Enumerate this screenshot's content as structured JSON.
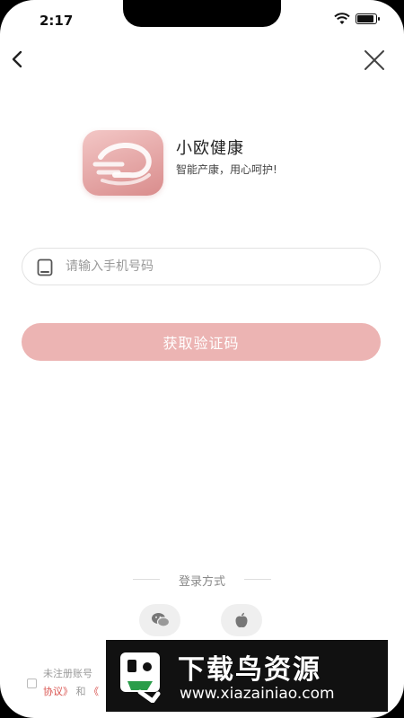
{
  "status_bar": {
    "time": "2:17"
  },
  "nav": {
    "back_icon": "chevron-left-icon",
    "close_icon": "close-icon"
  },
  "brand": {
    "name": "小欧健康",
    "slogan": "智能产康，用心呵护!",
    "logo_icon": "xiaoou-logo-icon",
    "logo_color": "#e3a4a3"
  },
  "login_form": {
    "phone_placeholder": "请输入手机号码",
    "phone_value": "",
    "phone_icon": "mobile-phone-icon",
    "get_code_label": "获取验证码",
    "button_color": "#ecb4b3"
  },
  "alt_login": {
    "title": "登录方式",
    "options": [
      {
        "name": "wechat",
        "icon": "wechat-icon"
      },
      {
        "name": "apple",
        "icon": "apple-icon"
      }
    ]
  },
  "agreement": {
    "line1": "未注册账号",
    "link1": "协议》",
    "and": "和",
    "link2": "《",
    "link_color": "#d9534f"
  },
  "watermark": {
    "title": "下载鸟资源",
    "url": "www.xiazainiao.com"
  }
}
